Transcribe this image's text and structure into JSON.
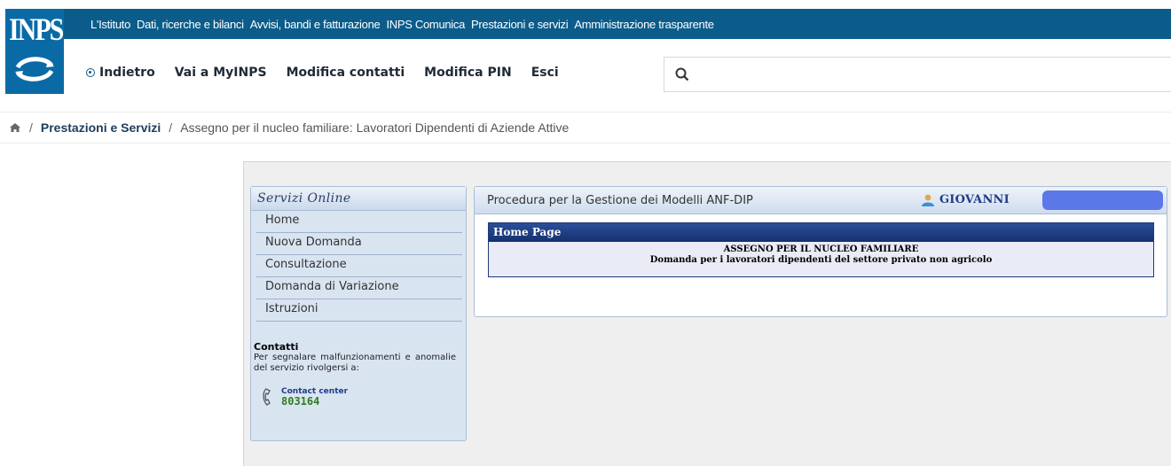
{
  "logo": {
    "text": "INPS"
  },
  "topnav": {
    "items": [
      "L'Istituto",
      "Dati, ricerche e bilanci",
      "Avvisi, bandi e fatturazione",
      "INPS Comunica",
      "Prestazioni e servizi",
      "Amministrazione trasparente"
    ]
  },
  "subnav": {
    "back_label": "Indietro",
    "myinps_label": "Vai a MyINPS",
    "contacts_label": "Modifica contatti",
    "pin_label": "Modifica PIN",
    "exit_label": "Esci"
  },
  "search": {
    "icon": "search-icon",
    "placeholder": ""
  },
  "breadcrumb": {
    "home_icon": "home-icon",
    "level1": "Prestazioni e Servizi",
    "level2": "Assegno per il nucleo familiare: Lavoratori Dipendenti di Aziende Attive",
    "separator": "/"
  },
  "sidebar": {
    "title": "Servizi Online",
    "items": [
      {
        "label": "Home"
      },
      {
        "label": "Nuova Domanda"
      },
      {
        "label": "Consultazione"
      },
      {
        "label": "Domanda di Variazione"
      },
      {
        "label": "Istruzioni"
      }
    ],
    "contacts": {
      "title": "Contatti",
      "text": "Per segnalare malfunzionamenti e anomalie del servizio rivolgersi a:",
      "cc_label": "Contact center",
      "cc_number": "803164"
    }
  },
  "panel": {
    "title": "Procedura per la Gestione dei Modelli ANF-DIP",
    "user_name": "GIOVANNI",
    "home": {
      "header": "Home Page",
      "line1": "ASSEGNO PER IL NUCLEO FAMILIARE",
      "line2": "Domanda per i lavoratori dipendenti del settore privato non agricolo"
    }
  },
  "colors": {
    "brand_blue": "#0b5c8a",
    "logo_blue": "#0a6aa6",
    "panel_blue": "#d9e4f1",
    "home_header": "#14306e",
    "cc_green": "#2e7d1d"
  }
}
